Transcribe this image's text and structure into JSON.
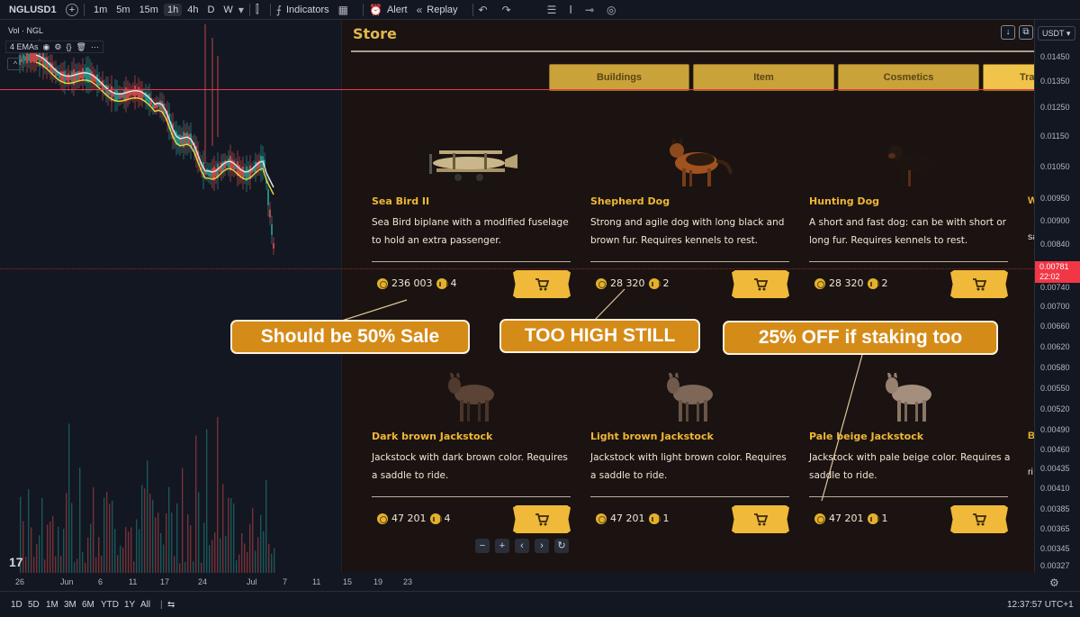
{
  "toolbar": {
    "symbol": "NGLUSD1",
    "add_icon": "plus-circle-icon",
    "timeframes": [
      "1m",
      "5m",
      "15m",
      "1h",
      "4h",
      "D",
      "W"
    ],
    "active_timeframe": "1h",
    "indicators_label": "Indicators",
    "alert_label": "Alert",
    "replay_label": "Replay"
  },
  "chart": {
    "vol_legend": "Vol · NGL",
    "ema_legend": "4 EMAs",
    "collapse_icon": "chevron-up-icon",
    "logo": "17",
    "colors": {
      "red_line": "#f23645",
      "ema_yellow": "#f2d33a",
      "ema_white": "#e6e6e6",
      "candle_up": "#26a69a",
      "candle_down": "#ef5350"
    }
  },
  "store": {
    "title": "Store",
    "tabs": [
      {
        "label": "Buildings"
      },
      {
        "label": "Item"
      },
      {
        "label": "Cosmetics"
      },
      {
        "label": "Tra"
      }
    ],
    "items": [
      {
        "name": "Sea Bird II",
        "desc": "Sea Bird biplane with a modified fuselage to hold an extra passenger.",
        "price": "236 003",
        "level": "4",
        "icon": "biplane-icon"
      },
      {
        "name": "Shepherd Dog",
        "desc": "Strong and agile dog with long black and brown fur. Requires kennels to rest.",
        "price": "28 320",
        "level": "2",
        "icon": "shepherd-dog-icon"
      },
      {
        "name": "Hunting Dog",
        "desc": "A short and fast dog: can be with short or long fur. Requires kennels to rest.",
        "price": "28 320",
        "level": "2",
        "icon": "hunting-dog-icon"
      },
      {
        "name": "Dark brown Jackstock",
        "desc": "Jackstock with dark brown color. Requires a saddle to ride.",
        "price": "47 201",
        "level": "4",
        "icon": "donkey-icon"
      },
      {
        "name": "Light brown Jackstock",
        "desc": "Jackstock with light brown color. Requires a saddle to ride.",
        "price": "47 201",
        "level": "1",
        "icon": "donkey-icon"
      },
      {
        "name": "Pale beige Jackstock",
        "desc": "Jackstock with pale beige color. Requires a saddle to ride.",
        "price": "47 201",
        "level": "1",
        "icon": "donkey-icon"
      }
    ],
    "edge_cut": {
      "row1_name": "W",
      "row1_desc": "sa",
      "row2_name": "B",
      "row2_desc": "ri"
    },
    "colors": {
      "tab": "#c9a33a",
      "tab_active": "#f0c34b",
      "item_name": "#f0b636",
      "button": "#f0b93a"
    }
  },
  "annotations": [
    {
      "text": "Should be 50% Sale"
    },
    {
      "text": "TOO HIGH STILL"
    },
    {
      "text": "25% OFF if staking too"
    }
  ],
  "price_axis": {
    "currency": "USDT",
    "labels": [
      "0.01450",
      "0.01350",
      "0.01250",
      "0.01150",
      "0.01050",
      "0.00950",
      "0.00900",
      "0.00840",
      "0.00781",
      "0.00740",
      "0.00700",
      "0.00660",
      "0.00620",
      "0.00580",
      "0.00550",
      "0.00520",
      "0.00490",
      "0.00460",
      "0.00435",
      "0.00410",
      "0.00385",
      "0.00365",
      "0.00345",
      "0.00327"
    ],
    "current_price": "0.00781",
    "countdown": "22:02"
  },
  "time_axis": {
    "labels": [
      "26",
      "Jun",
      "6",
      "11",
      "17",
      "24",
      "Jul",
      "7",
      "11",
      "15",
      "19",
      "23"
    ]
  },
  "bottom_bar": {
    "ranges": [
      "1D",
      "5D",
      "1M",
      "3M",
      "6M",
      "YTD",
      "1Y",
      "All"
    ],
    "clock": "12:37:57 UTC+1"
  }
}
